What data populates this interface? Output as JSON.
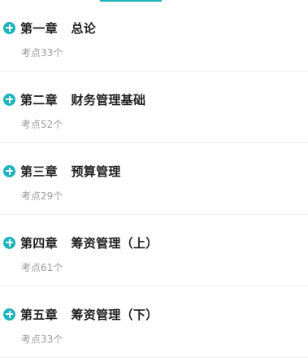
{
  "chapters": [
    {
      "title": "第一章   总论",
      "count": "考点33个"
    },
    {
      "title": "第二章   财务管理基础",
      "count": "考点52个"
    },
    {
      "title": "第三章   预算管理",
      "count": "考点29个"
    },
    {
      "title": "第四章   筹资管理（上）",
      "count": "考点61个"
    },
    {
      "title": "第五章   筹资管理（下）",
      "count": "考点33个"
    }
  ],
  "icons": {
    "expand": "plus-circle-icon"
  },
  "colors": {
    "accent": "#1bb3bd",
    "title": "#222222",
    "subtext": "#9a9a9a",
    "divider": "#ececec"
  }
}
